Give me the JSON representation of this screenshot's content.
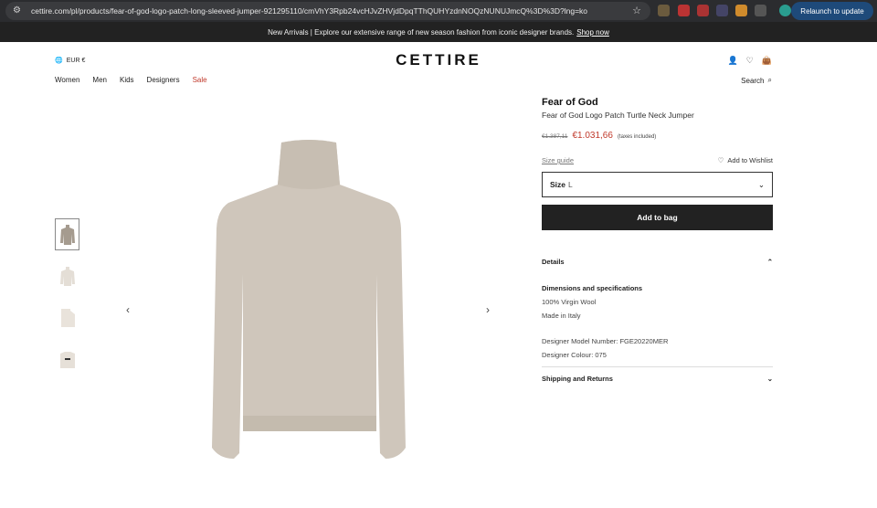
{
  "browser": {
    "url": "cettire.com/pl/products/fear-of-god-logo-patch-long-sleeved-jumper-921295110/cmVhY3Rpb24vcHJvZHVjdDpqTThQUHYzdnNOQzNUNUJmcQ%3D%3D?lng=ko",
    "relaunch_label": "Relaunch to update"
  },
  "announcement": {
    "text": "New Arrivals | Explore our extensive range of new season fashion from iconic designer brands.",
    "link": "Shop now"
  },
  "header": {
    "currency": "EUR €",
    "logo": "CETTIRE",
    "nav": [
      "Women",
      "Men",
      "Kids",
      "Designers",
      "Sale"
    ],
    "search_label": "Search"
  },
  "product": {
    "brand": "Fear of God",
    "name": "Fear of God Logo Patch Turtle Neck Jumper",
    "old_price": "€1.387,11",
    "price": "€1.031,66",
    "tax_note": "(taxes included)",
    "size_guide": "Size guide",
    "wishlist": "Add to Wishlist",
    "size_label": "Size",
    "size_value": "L",
    "add_to_bag": "Add to bag",
    "details_title": "Details",
    "dimensions_title": "Dimensions and specifications",
    "material": "100% Virgin Wool",
    "origin": "Made in Italy",
    "model_number": "Designer Model Number: FGE20220MER",
    "colour": "Designer Colour: 075",
    "shipping_title": "Shipping and Returns"
  },
  "colors": {
    "sweater": "#cfc6bb",
    "sale": "#c0392b"
  }
}
